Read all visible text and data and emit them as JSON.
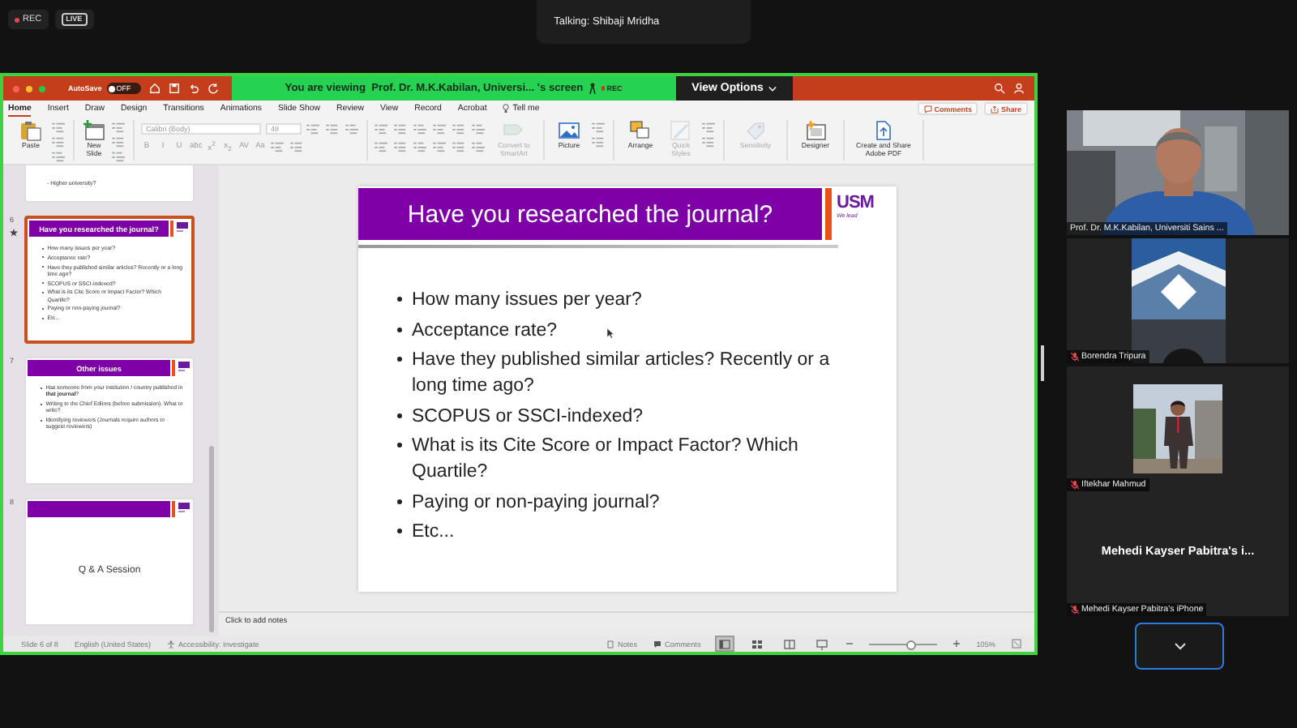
{
  "meeting": {
    "recording_badge": "REC",
    "live_badge": "LIVE",
    "talking": "Talking: Shibaji Mridha"
  },
  "powerpoint": {
    "autosave": {
      "label": "AutoSave",
      "toggle_text": "OFF",
      "on": false
    },
    "sharing_banner": {
      "text": "You are viewing  Prof. Dr. M.K.Kabilan, Universi... 's screen",
      "recording": "REC"
    },
    "view_options": "View Options",
    "tabs": [
      {
        "label": "Home",
        "selected": true
      },
      {
        "label": "Insert",
        "selected": false
      },
      {
        "label": "Draw",
        "selected": false
      },
      {
        "label": "Design",
        "selected": false
      },
      {
        "label": "Transitions",
        "selected": false
      },
      {
        "label": "Animations",
        "selected": false
      },
      {
        "label": "Slide Show",
        "selected": false
      },
      {
        "label": "Review",
        "selected": false
      },
      {
        "label": "View",
        "selected": false
      },
      {
        "label": "Record",
        "selected": false
      },
      {
        "label": "Acrobat",
        "selected": false
      }
    ],
    "tell_me": "Tell me",
    "comments_button": "Comments",
    "share_button": "Share",
    "ribbon": {
      "groups": [
        {
          "kind": "clipboard",
          "buttons": [
            {
              "label": "Paste",
              "kind": "paste",
              "disabled": false
            }
          ]
        },
        {
          "kind": "slides",
          "buttons": [
            {
              "label": "New Slide",
              "kind": "new_slide",
              "disabled": false
            }
          ]
        },
        {
          "kind": "font",
          "font_name": "Calibri (Body)",
          "font_size": "48",
          "format_buttons": [
            "B",
            "I",
            "U",
            "abc",
            "x$^{2}$",
            "x$_{2}$",
            "AV",
            "Aa"
          ]
        },
        {
          "kind": "paragraph",
          "buttons": [
            {
              "label": "Convert to SmartArt",
              "kind": "smartart",
              "disabled": true
            }
          ]
        },
        {
          "kind": "insert",
          "buttons": [
            {
              "label": "Picture",
              "kind": "picture",
              "disabled": false
            }
          ]
        },
        {
          "kind": "drawing",
          "buttons": [
            {
              "label": "Arrange",
              "kind": "arrange",
              "disabled": false
            },
            {
              "label": "Quick Styles",
              "kind": "quick_styles",
              "disabled": true
            }
          ]
        },
        {
          "kind": "sensitivity",
          "buttons": [
            {
              "label": "Sensitivity",
              "kind": "sensitivity",
              "disabled": true
            }
          ]
        },
        {
          "kind": "designer",
          "buttons": [
            {
              "label": "Designer",
              "kind": "designer",
              "disabled": false
            }
          ]
        },
        {
          "kind": "acrobat",
          "buttons": [
            {
              "label": "Create and Share Adobe PDF",
              "kind": "pdf",
              "disabled": false
            }
          ]
        }
      ]
    },
    "thumbnails": [
      {
        "kind": "partial",
        "lines": [
          "- Higher university?"
        ],
        "selected": false
      },
      {
        "kind": "bullets",
        "number": "6",
        "title": "Have you researched the journal?",
        "selected": true,
        "has_animation": true,
        "bullets": [
          "How many issues per year?",
          "Acceptance rate?",
          "Have they published similar articles? Recently or a long time ago?",
          "SCOPUS or SSCI-indexed?",
          "What is its Cite Score or Impact Factor? Which Quartile?",
          "Paying or non-paying journal?",
          "Etc..."
        ]
      },
      {
        "kind": "bullets",
        "number": "7",
        "title": "Other issues",
        "selected": false,
        "has_animation": false,
        "bullets": [
          "Has someone from your institution / country published in **that journal**?",
          "Writing to the Chief Editors (before submission). What to write?",
          "Identifying reviewers (Journals require authors to suggest reviewers)"
        ]
      },
      {
        "kind": "title_only",
        "number": "8",
        "text": "Q & A Session",
        "selected": false,
        "has_animation": false
      }
    ],
    "slide": {
      "title": "Have you researched the journal?",
      "logo": "USM",
      "tagline": "We lead",
      "bullets": [
        "How many issues per year?",
        "Acceptance rate?",
        "Have they published similar articles? Recently or a long time ago?",
        "SCOPUS or SSCI-indexed?",
        "What is its Cite Score or Impact Factor? Which Quartile?",
        "Paying or non-paying journal?",
        "Etc..."
      ]
    },
    "notes_placeholder": "Click to add notes",
    "status_bar": {
      "slide_info": "Slide 6 of 8",
      "language": "English (United States)",
      "accessibility": "Accessibility: Investigate",
      "notes": "Notes",
      "comments": "Comments",
      "zoom": "105%",
      "zoom_slider": {
        "level": 0.6
      },
      "views": [
        {
          "kind": "normal",
          "selected": true
        },
        {
          "kind": "sorter",
          "selected": false
        },
        {
          "kind": "reading",
          "selected": false
        },
        {
          "kind": "slideshow",
          "selected": false
        }
      ]
    }
  },
  "participants": [
    {
      "kind": "video",
      "name": "Prof. Dr. M.K.Kabilan, Universiti Sains ...",
      "muted": false
    },
    {
      "kind": "video",
      "name": "Borendra Tripura",
      "muted": true
    },
    {
      "kind": "video",
      "name": "Iftekhar Mahmud",
      "muted": true
    },
    {
      "kind": "avatar",
      "display_name": "Mehedi Kayser Pabitra's i...",
      "name": "Mehedi Kayser Pabitra's iPhone",
      "muted": true
    }
  ]
}
